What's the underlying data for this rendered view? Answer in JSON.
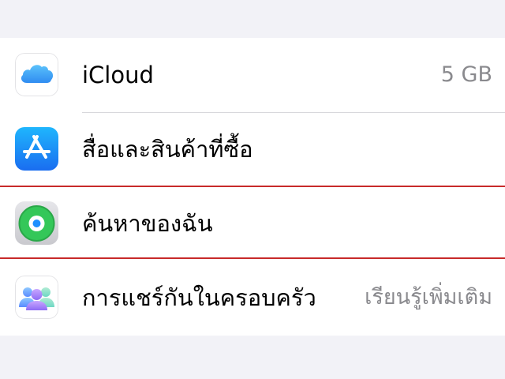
{
  "settings_list": {
    "rows": [
      {
        "label": "iCloud",
        "detail": "5 GB",
        "icon": "icloud-icon"
      },
      {
        "label": "สื่อและสินค้าที่ซื้อ",
        "detail": "",
        "icon": "app-store-icon"
      },
      {
        "label": "ค้นหาของฉัน",
        "detail": "",
        "icon": "find-my-icon"
      },
      {
        "label": "การแชร์กันในครอบครัว",
        "detail": "เรียนรู้เพิ่มเติม",
        "icon": "family-sharing-icon"
      }
    ]
  },
  "colors": {
    "background": "#f2f2f7",
    "highlight_border": "#c82a2a",
    "detail_text": "#8a8a8e"
  }
}
